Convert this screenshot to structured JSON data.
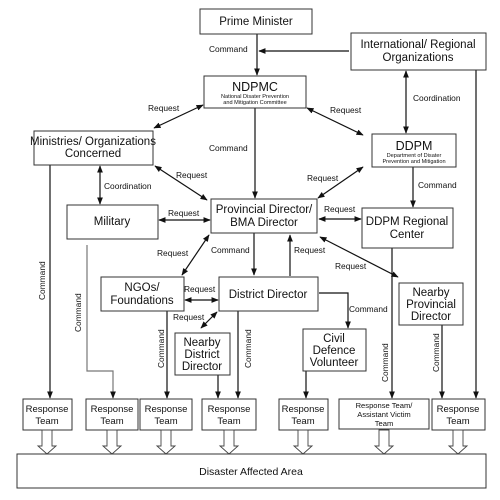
{
  "nodes": {
    "prime_minister": "Prime Minister",
    "international": [
      "International/ Regional",
      "Organizations"
    ],
    "ndpmc": {
      "title": "NDPMC",
      "subtitle": [
        "National Disater Prevention",
        "and Mitigation Committee"
      ]
    },
    "ministries": [
      "Ministries/ Organizations",
      "Concerned"
    ],
    "ddpm": {
      "title": "DDPM",
      "subtitle": [
        "Department of Disater",
        "Prevention and Mitigation"
      ]
    },
    "military": "Military",
    "provincial": [
      "Provincial Director/",
      "BMA Director"
    ],
    "ddpm_regional": [
      "DDPM Regional",
      "Center"
    ],
    "ngos": [
      "NGOs/",
      "Foundations"
    ],
    "district": "District Director",
    "nearby_provincial": [
      "Nearby",
      "Provincial",
      "Director"
    ],
    "nearby_district": [
      "Nearby",
      "District",
      "Director"
    ],
    "civil_defence": [
      "Civil",
      "Defence",
      "Volunteer"
    ],
    "response_team": [
      "Response",
      "Team"
    ],
    "response_team_victim": [
      "Response Team/",
      "Assistant Victim",
      "Team"
    ],
    "disaster_area": "Disaster Affected Area"
  },
  "edge_labels": {
    "command": "Command",
    "request": "Request",
    "coordination": "Coordination"
  }
}
